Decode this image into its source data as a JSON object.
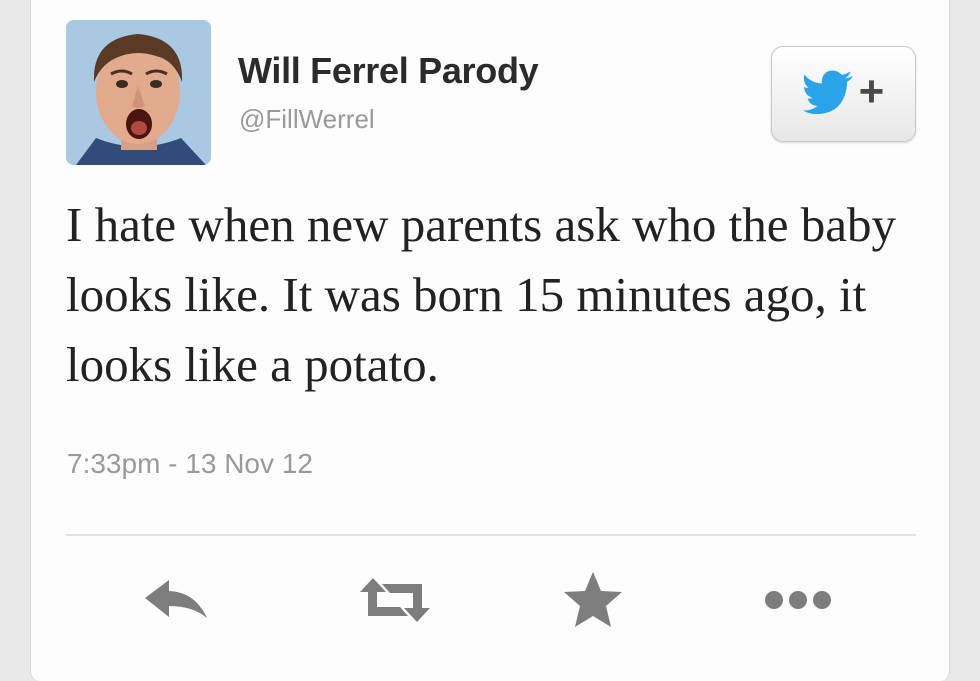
{
  "tweet": {
    "display_name": "Will Ferrel Parody",
    "handle": "@FillWerrel",
    "text": "I hate when new parents ask who the baby looks like. It was born 15 minutes ago, it looks like a potato.",
    "timestamp": "7:33pm - 13 Nov 12"
  },
  "follow_button": {
    "plus_label": "+",
    "icon": "twitter-bird-icon"
  },
  "actions": [
    {
      "icon": "reply-icon"
    },
    {
      "icon": "retweet-icon"
    },
    {
      "icon": "favorite-star-icon"
    },
    {
      "icon": "more-icon"
    }
  ],
  "colors": {
    "twitter_blue": "#2aa3e8",
    "icon_gray": "#7d7d7d",
    "text": "#222222",
    "muted": "#9a9a9a"
  }
}
